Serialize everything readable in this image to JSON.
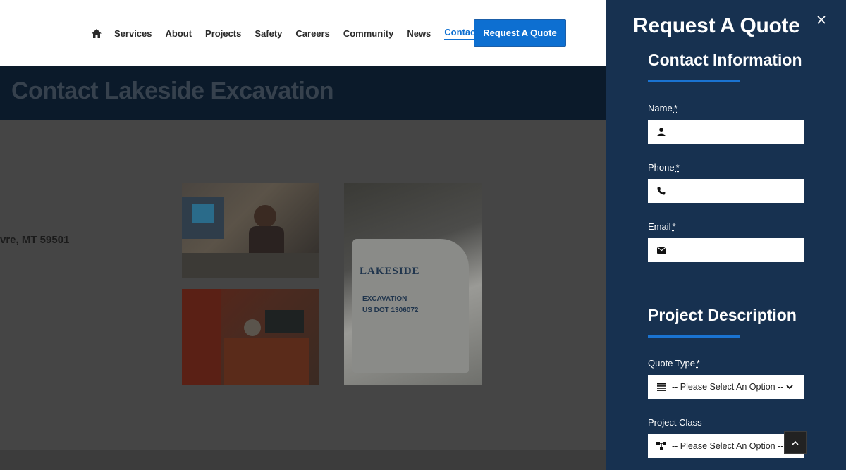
{
  "nav": {
    "items": [
      "Services",
      "About",
      "Projects",
      "Safety",
      "Careers",
      "Community",
      "News",
      "Contact"
    ],
    "active": "Contact",
    "cta_label": "Request A Quote"
  },
  "hero": {
    "title": "Contact Lakeside Excavation"
  },
  "content": {
    "address_fragment": "vre, MT 59501",
    "truck_logo": "LAKESIDE",
    "truck_line1": "EXCAVATION",
    "truck_line2": "US DOT 1306072"
  },
  "panel": {
    "title": "Request A Quote",
    "contact_section": "Contact Information",
    "project_section": "Project Description",
    "required_marker": "*",
    "fields": {
      "name_label": "Name",
      "phone_label": "Phone",
      "email_label": "Email",
      "quote_type_label": "Quote Type",
      "quote_type_value": "-- Please Select An Option --",
      "project_class_label": "Project Class",
      "project_class_value": "-- Please Select An Option --"
    }
  },
  "colors": {
    "accent": "#0d6fd1",
    "panel_bg": "#173150",
    "hero_bg": "#0b1a2a"
  },
  "icons": {
    "home": "home-icon",
    "close": "close-icon",
    "user": "user-icon",
    "phone": "phone-icon",
    "email": "envelope-icon",
    "list": "list-icon",
    "sitemap": "sitemap-icon",
    "chevron": "chevron-down-icon",
    "scroll": "chevron-up-icon"
  }
}
